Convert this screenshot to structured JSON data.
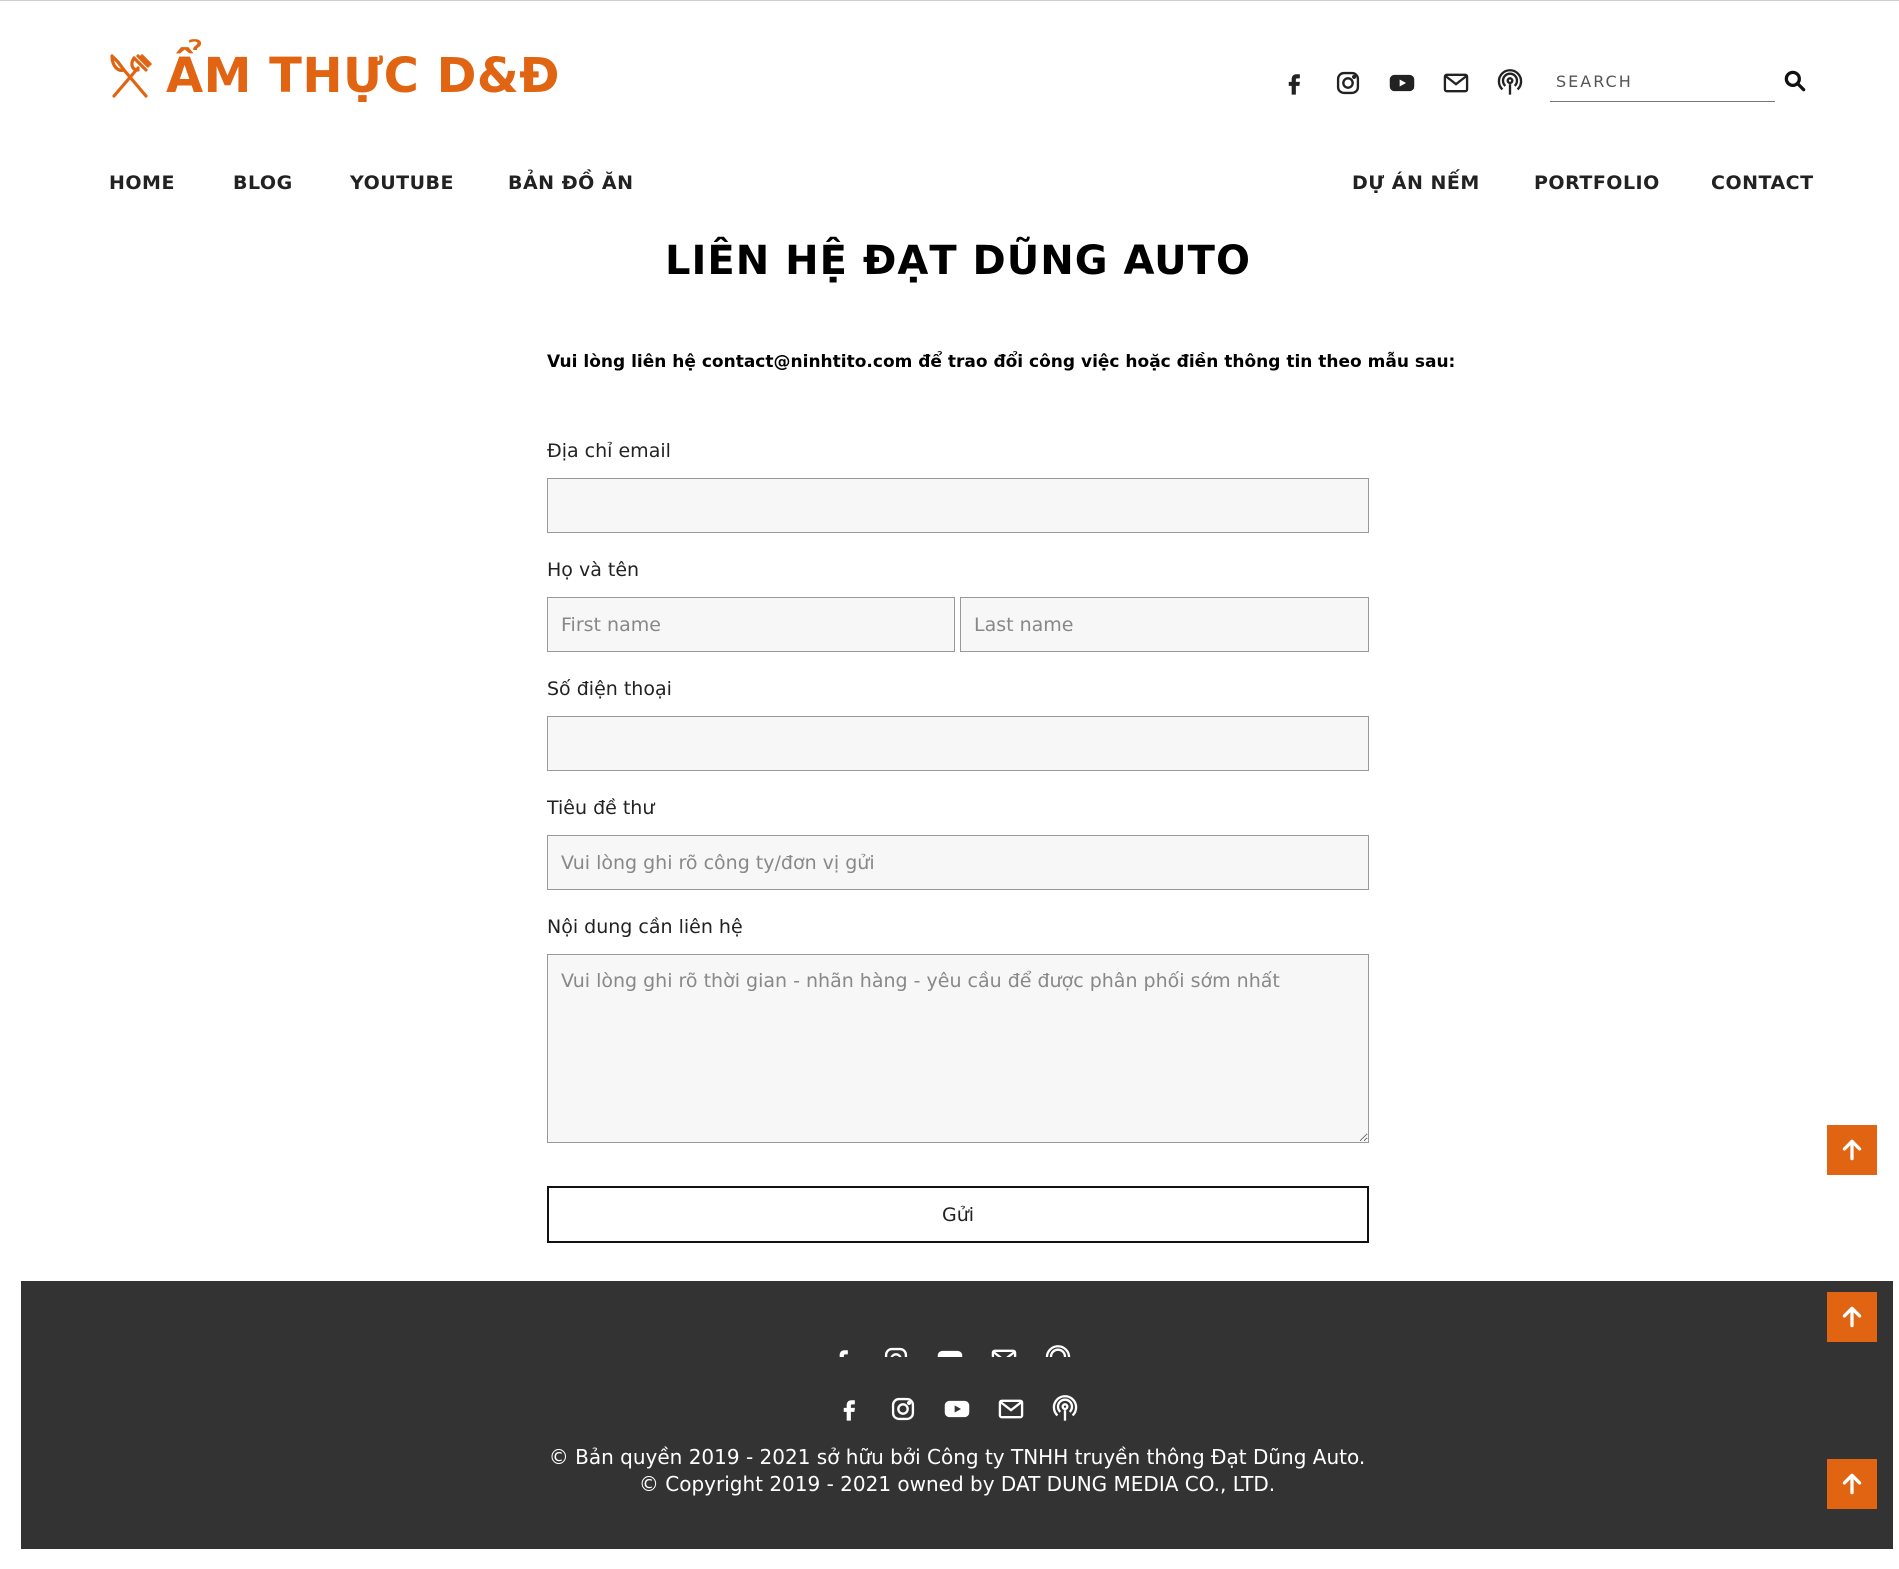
{
  "brand": {
    "name": "ẨM THỰC D&Đ",
    "logo_icon": "fork-knife-icon",
    "accent_color": "#e06412"
  },
  "header": {
    "social": [
      "facebook-icon",
      "instagram-icon",
      "youtube-icon",
      "mail-icon",
      "podcast-icon"
    ],
    "search_placeholder": "SEARCH"
  },
  "nav": {
    "left": [
      "HOME",
      "BLOG",
      "YOUTUBE",
      "BẢN ĐỒ ĂN"
    ],
    "right": [
      "DỰ ÁN NẾM",
      "PORTFOLIO",
      "CONTACT"
    ]
  },
  "main": {
    "title": "LIÊN HỆ ĐẠT DŨNG AUTO",
    "intro": "Vui lòng liên hệ contact@ninhtito.com để trao đổi công việc hoặc điền thông tin theo mẫu sau:"
  },
  "form": {
    "email_label": "Địa chỉ email",
    "email_value": "",
    "name_label": "Họ và tên",
    "first_name_placeholder": "First name",
    "last_name_placeholder": "Last name",
    "phone_label": "Số điện thoại",
    "phone_value": "",
    "subject_label": "Tiêu đề thư",
    "subject_placeholder": "Vui lòng ghi rõ công ty/đơn vị gửi",
    "message_label": "Nội dung cần liên hệ",
    "message_placeholder": "Vui lòng ghi rõ thời gian - nhãn hàng - yêu cầu để được phân phối sớm nhất",
    "submit_label": "Gửi"
  },
  "footer": {
    "background": "#333333",
    "copyright_vi": "© Bản quyền 2019 - 2021 sở hữu bởi Công ty TNHH truyền thông Đạt Dũng Auto.",
    "copyright_en": "© Copyright 2019 - 2021 owned by DAT DUNG MEDIA CO., LTD."
  },
  "back_to_top_icon": "arrow-up-icon"
}
